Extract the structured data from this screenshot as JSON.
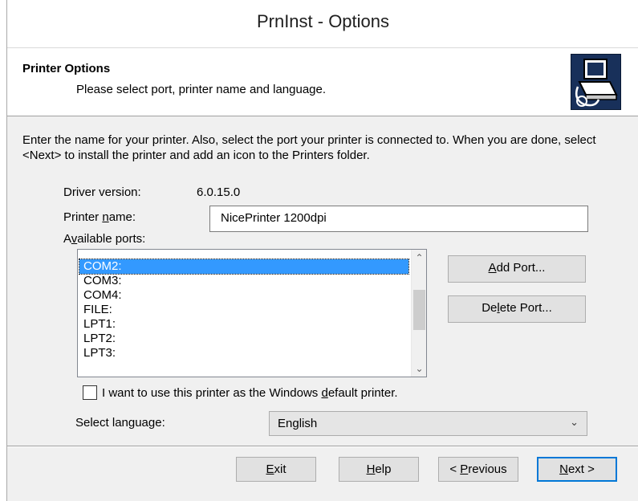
{
  "window": {
    "title": "PrnInst - Options"
  },
  "header": {
    "title": "Printer Options",
    "subtitle": "Please select port, printer name and language.",
    "icon": "printer-install-icon"
  },
  "description": "Enter the name for your printer. Also, select the port your printer is connected to. When you are done, select <Next> to install the printer and add an icon to the Printers folder.",
  "driver": {
    "label": "Driver version:",
    "value": "6.0.15.0"
  },
  "printer_name": {
    "label_pre": "Printer ",
    "label_u": "n",
    "label_post": "ame:",
    "value": "NicePrinter 1200dpi"
  },
  "ports": {
    "label_pre": "A",
    "label_u": "v",
    "label_post": "ailable ports:",
    "items": [
      "COM2:",
      "COM3:",
      "COM4:",
      "FILE:",
      "LPT1:",
      "LPT2:",
      "LPT3:"
    ],
    "selected_index": 0,
    "add_pre": "",
    "add_u": "A",
    "add_post": "dd Port...",
    "delete_pre": "De",
    "delete_u": "l",
    "delete_post": "ete Port..."
  },
  "default_printer": {
    "label_pre": "I want to use this printer as the Windows ",
    "label_u": "d",
    "label_post": "efault printer.",
    "checked": false
  },
  "language": {
    "label": "Select language:",
    "value": "English"
  },
  "buttons": {
    "exit_u": "E",
    "exit_post": "xit",
    "help_u": "H",
    "help_post": "elp",
    "previous_pre": "< ",
    "previous_u": "P",
    "previous_post": "revious",
    "next_u": "N",
    "next_post": "ext >"
  },
  "colors": {
    "selection": "#3399ff",
    "header_icon_bg": "#18305a",
    "default_button_border": "#0078d7"
  }
}
